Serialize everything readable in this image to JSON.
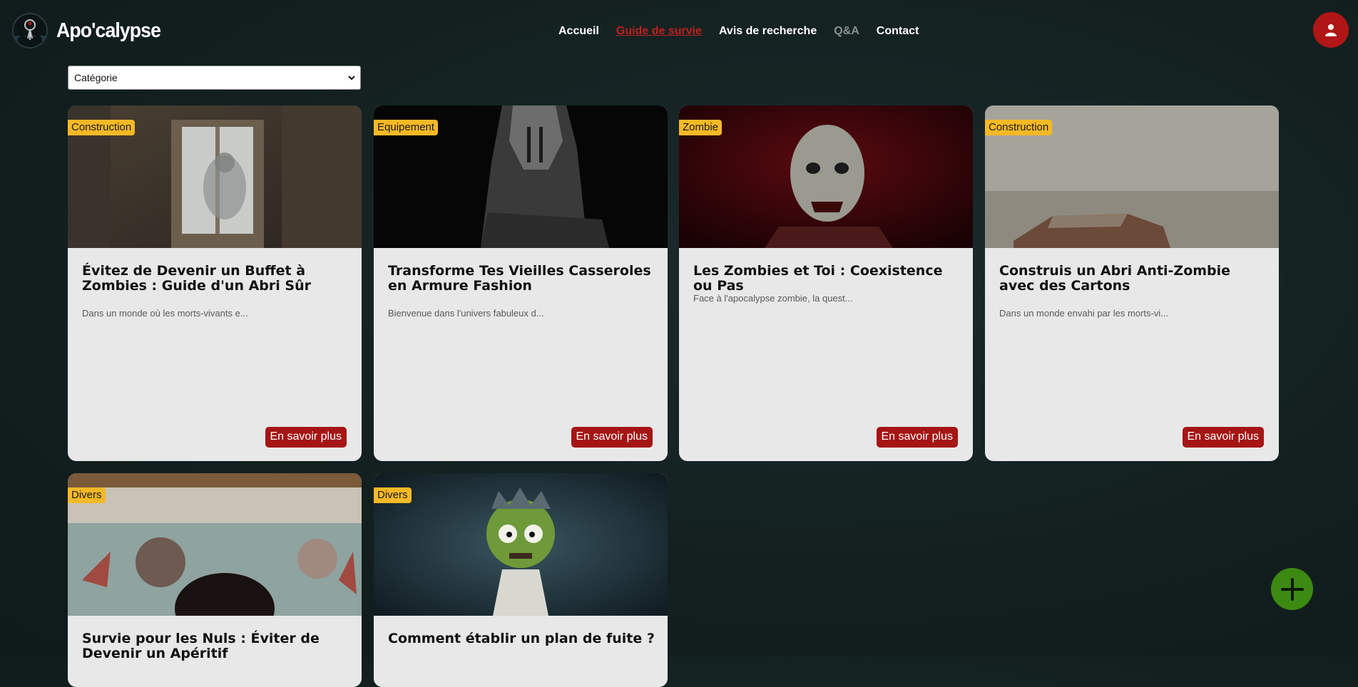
{
  "brand": {
    "name": "Apo'calypse"
  },
  "nav": {
    "items": [
      {
        "label": "Accueil",
        "state": "normal"
      },
      {
        "label": "Guide de survie",
        "state": "active"
      },
      {
        "label": "Avis de recherche",
        "state": "normal"
      },
      {
        "label": "Q&A",
        "state": "muted"
      },
      {
        "label": "Contact",
        "state": "normal"
      }
    ],
    "profile_icon": "user-icon"
  },
  "filter": {
    "selected": "Catégorie"
  },
  "cards": [
    {
      "category": "Construction",
      "title": "Évitez de Devenir un Buffet à Zombies : Guide d'un Abri Sûr",
      "excerpt": "Dans un monde où les morts-vivants e...",
      "button": "En savoir plus"
    },
    {
      "category": "Equipement",
      "title": "Transforme Tes Vieilles Casseroles en Armure Fashion",
      "excerpt": "Bienvenue dans l'univers fabuleux d...",
      "button": "En savoir plus"
    },
    {
      "category": "Zombie",
      "title": "Les Zombies et Toi : Coexistence ou Pas",
      "excerpt": "Face à l'apocalypse zombie, la quest...",
      "button": "En savoir plus"
    },
    {
      "category": "Construction",
      "title": "Construis un Abri Anti-Zombie avec des Cartons",
      "excerpt": "Dans un monde envahi par les morts-vi...",
      "button": "En savoir plus"
    },
    {
      "category": "Divers",
      "title": "Survie pour les Nuls : Éviter de Devenir un Apéritif"
    },
    {
      "category": "Divers",
      "title": "Comment établir un plan de fuite ?"
    }
  ],
  "fab": {
    "icon": "plus-icon"
  },
  "colors": {
    "accent": "#a61515",
    "badge": "#f6b926",
    "active_link": "#c02020",
    "fab": "#3d8a12"
  }
}
